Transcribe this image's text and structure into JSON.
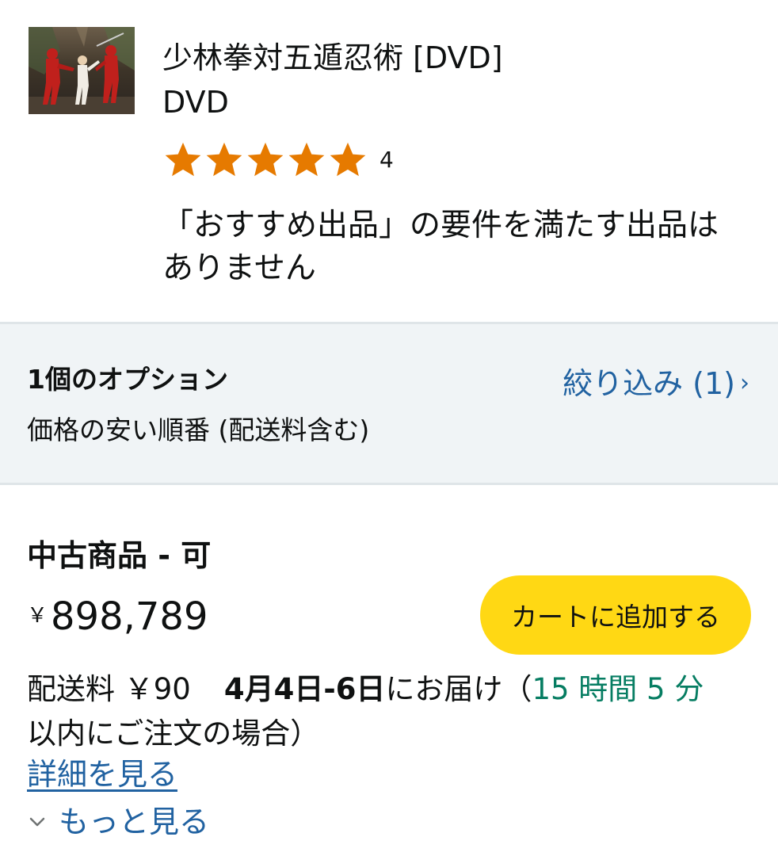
{
  "product": {
    "title": "少林拳対五遁忍術 [DVD]",
    "format": "DVD",
    "rating_stars": 5,
    "rating_count": "4",
    "no_featured_offer": "「おすすめ出品」の要件を満たす出品はありません"
  },
  "options": {
    "count_label": "1個のオプション",
    "sort_label": "価格の安い順番 (配送料含む)",
    "filter_label": "絞り込み (1)",
    "filter_chevron": "›"
  },
  "offer": {
    "condition": "中古商品 - 可",
    "currency_symbol": "￥",
    "price": "898,789",
    "add_to_cart": "カートに追加する",
    "shipping": "配送料 ￥90",
    "delivery_date": "4月4日-6日",
    "delivery_suffix": "にお届け（",
    "countdown": "15 時間 5 分",
    "countdown_suffix": "以内にご注文の場合）",
    "details_link": "詳細を見る",
    "see_more": "もっと見る"
  },
  "colors": {
    "star": "#e67a00",
    "link": "#2162a1",
    "countdown": "#067d62",
    "cart_button": "#ffd814",
    "options_bg": "#f0f4f6"
  }
}
